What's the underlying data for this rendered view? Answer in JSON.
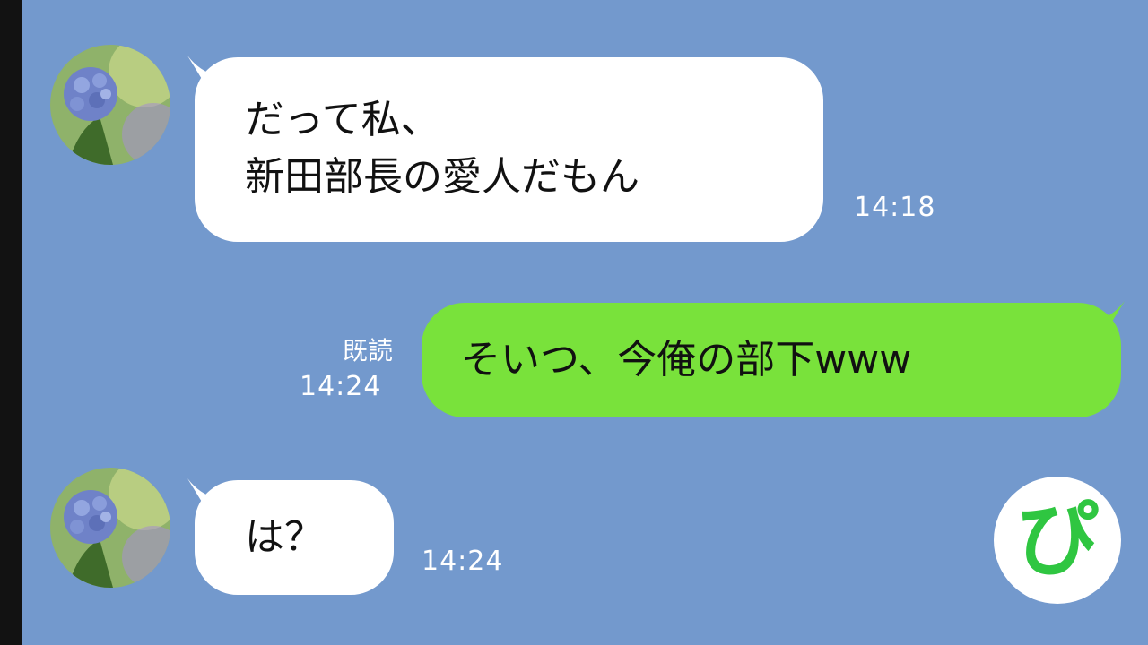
{
  "messages": [
    {
      "side": "incoming",
      "line1": "だって私、",
      "line2": "新田部長の愛人だもん",
      "time": "14:18"
    },
    {
      "side": "outgoing",
      "text": "そいつ、今俺の部下www",
      "read_label": "既読",
      "time": "14:24"
    },
    {
      "side": "incoming",
      "text": "は？",
      "time": "14:24"
    }
  ],
  "stamp": {
    "glyph": "ぴ",
    "icon": "pi-stamp-icon"
  },
  "colors": {
    "background": "#7399cd",
    "incoming_bubble": "#ffffff",
    "outgoing_bubble": "#79e23b",
    "stamp_green": "#2fc641"
  }
}
